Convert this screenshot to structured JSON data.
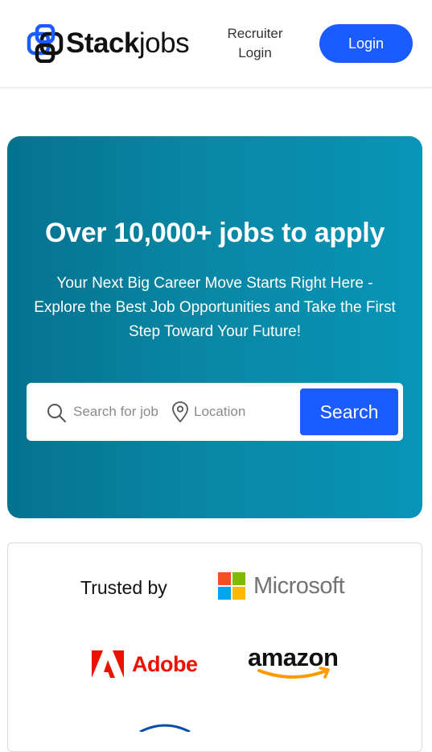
{
  "header": {
    "logo_bold": "Stack",
    "logo_light": "jobs",
    "recruiter_line1": "Recruiter",
    "recruiter_line2": "Login",
    "login_label": "Login"
  },
  "hero": {
    "title": "Over 10,000+ jobs to apply",
    "subtitle": "Your Next Big Career Move Starts Right Here - Explore the Best Job Opportunities and Take the First Step Toward Your Future!",
    "search": {
      "job_placeholder": "Search for job",
      "location_placeholder": "Location",
      "button_label": "Search"
    }
  },
  "trusted": {
    "label": "Trusted by",
    "companies": {
      "microsoft": "Microsoft",
      "adobe": "Adobe",
      "amazon": "amazon"
    }
  },
  "colors": {
    "accent": "#1a5cff",
    "hero_start": "#04728f",
    "hero_end": "#0795b8",
    "adobe_red": "#eb1000",
    "amazon_orange": "#ff9900"
  }
}
